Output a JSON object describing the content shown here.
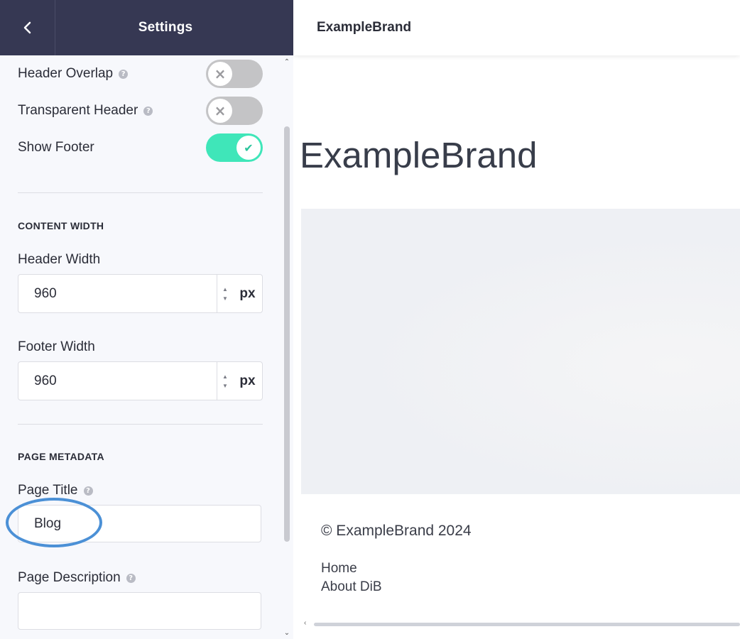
{
  "panel": {
    "title": "Settings",
    "toggles": [
      {
        "label": "Header Overlap",
        "help": true,
        "on": false
      },
      {
        "label": "Transparent Header",
        "help": true,
        "on": false
      },
      {
        "label": "Show Footer",
        "help": false,
        "on": true
      }
    ],
    "content_width": {
      "section_title": "CONTENT WIDTH",
      "header_width_label": "Header Width",
      "header_width_value": "960",
      "footer_width_label": "Footer Width",
      "footer_width_value": "960",
      "unit": "px"
    },
    "page_metadata": {
      "section_title": "PAGE METADATA",
      "page_title_label": "Page Title",
      "page_title_value": "Blog",
      "page_description_label": "Page Description",
      "page_description_value": ""
    },
    "icons": {
      "back": "chevron-left-icon",
      "help": "question-circle-icon",
      "off": "x-icon",
      "on": "check-icon"
    }
  },
  "preview": {
    "brand": "ExampleBrand",
    "logo_text": "ExampleBrand",
    "copyright": "© ExampleBrand 2024",
    "footer_links": [
      "Home",
      "About DiB"
    ]
  },
  "colors": {
    "header_bg": "#363853",
    "toggle_on": "#3fe6b9",
    "toggle_off": "#c4c4c6",
    "highlight": "#4b90d6"
  }
}
